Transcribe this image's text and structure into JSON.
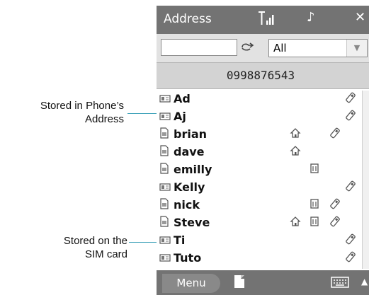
{
  "callouts": {
    "phone_line1": "Stored in Phone’s",
    "phone_line2": "Address",
    "sim_line1": "Stored on the",
    "sim_line2": "SIM card"
  },
  "titlebar": {
    "title": "Address",
    "signal_icon": "signal-icon",
    "sound_icon": "music-note-icon",
    "close_icon": "close-icon"
  },
  "search": {
    "value": "",
    "placeholder": "",
    "clear_icon": "clear-search-icon",
    "filter_selected": "All"
  },
  "number_bar": {
    "number": "0998876543"
  },
  "contacts": [
    {
      "name": "Ad",
      "source": "phone",
      "icons": [
        "mobile-icon"
      ]
    },
    {
      "name": "Aj",
      "source": "phone",
      "icons": [
        "mobile-icon"
      ]
    },
    {
      "name": "brian",
      "source": "sim",
      "icons": [
        "home-icon",
        "mobile-icon"
      ]
    },
    {
      "name": "dave",
      "source": "sim",
      "icons": [
        "home-icon"
      ]
    },
    {
      "name": "emilly",
      "source": "sim",
      "icons": [
        "office-icon"
      ]
    },
    {
      "name": "Kelly",
      "source": "phone",
      "icons": [
        "mobile-icon"
      ]
    },
    {
      "name": "nick",
      "source": "sim",
      "icons": [
        "office-icon",
        "mobile-icon"
      ]
    },
    {
      "name": "Steve",
      "source": "sim",
      "icons": [
        "home-icon",
        "office-icon",
        "mobile-icon"
      ]
    },
    {
      "name": "Ti",
      "source": "phone",
      "icons": [
        "mobile-icon"
      ]
    },
    {
      "name": "Tuto",
      "source": "phone",
      "icons": [
        "mobile-icon"
      ]
    }
  ],
  "softbar": {
    "menu_label": "Menu",
    "new_icon": "new-document-icon",
    "keyboard_icon": "keyboard-icon",
    "up_icon": "up-arrow-icon"
  },
  "colors": {
    "titlebar_bg": "#737373",
    "callout_line": "#3aa0b8",
    "number_bar_bg": "#d3d3d3"
  }
}
